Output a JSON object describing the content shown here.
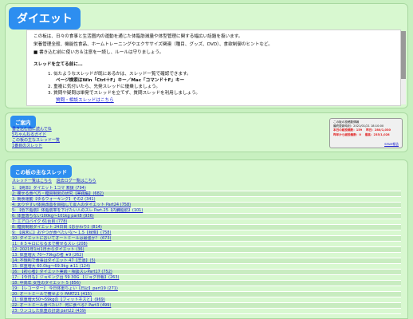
{
  "header": {
    "title": "ダイエット",
    "intro_lines": [
      "この板は、日々の食事と生活圏内の運動を通じた体脂肪減量や体型管理に関する幅広い話題を扱います。",
      "栄養管理全般、機能性食品、ホームトレーニングやエクササイズ関連（種目、グッズ、DVD）、食欲制御のヒントなど。",
      "■ 書き込む前に使い方＆注意を一読し、ルールは守りましょう。"
    ],
    "rules_heading": "スレッドを立てる前に…",
    "rules": [
      "1. 似たようなスレッドが既にあるかは、スレッド一覧で確認できます。",
      "ページ検索はWin「Ctrl＋F」キー／Mac「コマンド＋F」キー",
      "2. 重複に気付いたら、先発スレッドに優乗しましょう。",
      "3. 質問や疑問は単発でスレッドを立てず、質問スレッドを利用しましょう。",
      "質問・相談スレッドはこちら"
    ]
  },
  "guide": {
    "title": "ご案内",
    "links": [
      "書き込む前に読んでね",
      "5ちゃんねるガイド",
      "この板の主なスレッド一覧",
      "1番目のスレッド"
    ],
    "info": {
      "heading": "この板の投稿数情報",
      "rows": [
        "最終更新時刻：2021/01/21 18:10:00",
        "本日の総投稿数：159 　昨日：280/1,030",
        "昨年から総投稿数：0 　最高：235/1,028"
      ],
      "link": "SPAM報告"
    }
  },
  "threads": {
    "title": "この板の主なスレッド",
    "top_links": [
      "スレッド一覧はこちら",
      "過去ログ一覧はこちら"
    ],
    "items": [
      "1: 【純本】ダイエット 1コマ 救援 (794)",
      "2: 痩せる食べ方・糖質制限の研究【実践編】(682)",
      "3: 朝食運動【ゆるウォーキング】その2 (341)",
      "4: 太りやすい体質改善を目指して友人のダイエット Part24 (758)",
      "5: 【低下脂肪】体脂肪率を下げたい人のスレ Part.25【内臓脂肪】(101)",
      "6: 体重落ちない100kg～101kg part8 (936)",
      "7: エアロバイク 61台目 (778)",
      "8: 糖質制限ダイエット 24日目【おかわり】(814)",
      "9: 【週末に】おやつが食べたいな～ 1.5【我慢】(758)",
      "10: ダイエットにおいてオートミールは最強か？ (673)",
      "11: ８５キロになるまで痩せるスレ (208)",
      "12: 2021年1月1日からダイエット (36)",
      "13: 体重増大 70～79kgの者 ★9 (262)",
      "14: 不規則で食事はダイエット 47【王道】(5)",
      "15: 体重増大 60.0kg～69.9kg ★11 (124)",
      "16: 【初心者】ダイエット実践・相談スレPart17 (752)",
      "17: 【今日も】ジョギング台 59 30G 【ジョグ日報】(263)",
      "18: 中高年 女性のダイエット 5 (856)",
      "19: 【レコーダー】 今日体重ちょい【日記】part19 (271)",
      "20: オートミールで痩せよう PART21 (415)",
      "21: 体重増大50～59kgの【フィットネスと】(969)",
      "22: オートミール食べたい？ 何に食べる？Part3 (499)",
      "23: ウンコした体重の計測 part22 (439)"
    ]
  },
  "colors": {
    "background": "#c8f0c0",
    "panel": "#d8f8d0",
    "badge": "#2d8ef0",
    "link": "#1a22cc",
    "alert": "#e02020"
  }
}
